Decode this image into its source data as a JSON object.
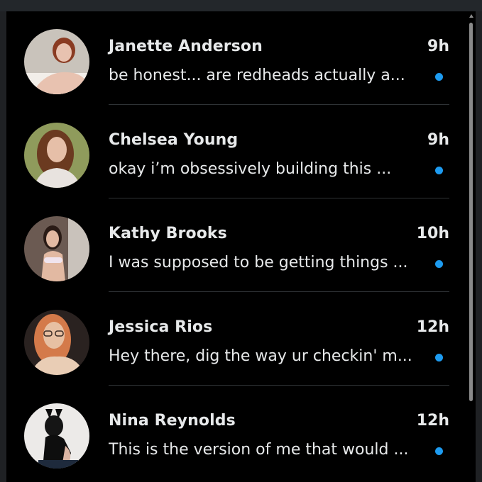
{
  "conversations": [
    {
      "name": "Janette Anderson",
      "time": "9h",
      "preview": "be honest... are redheads actually a...",
      "unread": true,
      "avatar": {
        "skin": "#e8c2b0",
        "hair": "#8a3b22",
        "bg": "#c9c3bb",
        "accent": "#f2eee9"
      }
    },
    {
      "name": "Chelsea Young",
      "time": "9h",
      "preview": "okay i’m obsessively building this ...",
      "unread": true,
      "avatar": {
        "skin": "#e6bfa8",
        "hair": "#6b3a20",
        "bg": "#8f9b5c",
        "accent": "#e8e3df"
      }
    },
    {
      "name": "Kathy Brooks",
      "time": "10h",
      "preview": "I was supposed to be getting things ...",
      "unread": true,
      "avatar": {
        "skin": "#e2b9a2",
        "hair": "#2a1b16",
        "bg": "#6b5a52",
        "accent": "#f0e4ee"
      }
    },
    {
      "name": "Jessica Rios",
      "time": "12h",
      "preview": "Hey there, dig the way ur checkin' m...",
      "unread": true,
      "avatar": {
        "skin": "#e7c0a3",
        "hair": "#d47a4a",
        "bg": "#2a2220",
        "accent": "#e9cdb5"
      }
    },
    {
      "name": "Nina Reynolds",
      "time": "12h",
      "preview": "This is the version of me that would ...",
      "unread": true,
      "avatar": {
        "skin": "#dcb5a3",
        "hair": "#151515",
        "bg": "#eceae8",
        "accent": "#0e0e0e"
      }
    }
  ],
  "colors": {
    "background": "#000000",
    "text": "#e7e9ea",
    "unread_dot": "#1d9bf0",
    "divider": "#2f3336"
  }
}
